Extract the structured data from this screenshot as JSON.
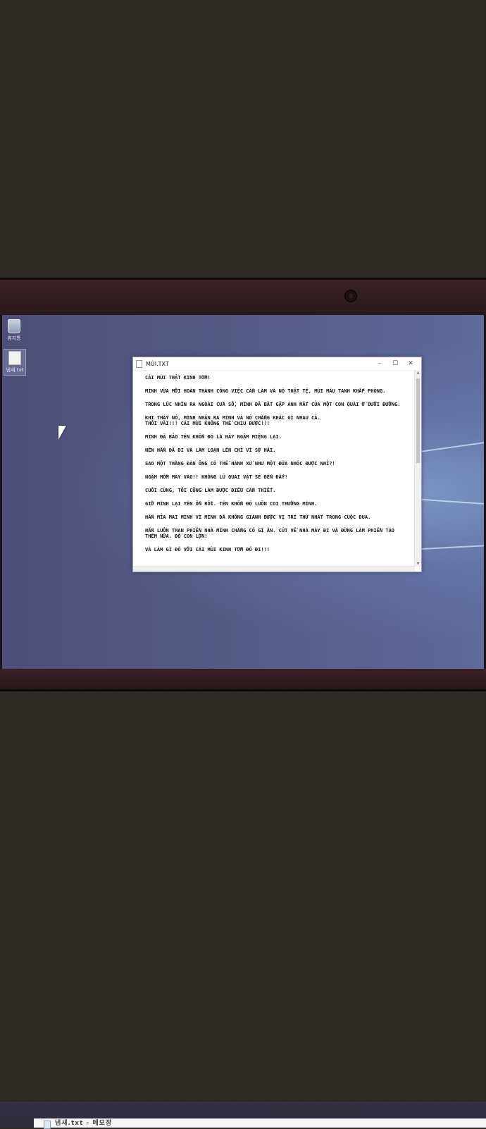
{
  "desktop": {
    "icons": [
      {
        "name": "recycle-bin",
        "label": "휴지통"
      },
      {
        "name": "text-file",
        "label": "냄새.txt"
      }
    ]
  },
  "notepad": {
    "title": "MÙI.TXT",
    "controls": {
      "minimize": "–",
      "maximize": "☐",
      "close": "✕"
    },
    "lines": [
      "CÁI MÙI THẬT KINH TỞM!",
      "MÌNH VỪA MỚI HOÀN THÀNH CÔNG VIỆC CẦN LÀM VÀ NÓ THẬT TỆ, MÙI MÁU TANH KHẮP PHÒNG.",
      "TRONG LÚC NHÌN RA NGOÀI CỬA SỔ, MÌNH ĐÃ BẮT GẶP ÁNH MẮT CỦA MỘT CON QUÁI Ở DƯỚI ĐƯỜNG.",
      "KHI THẤY NÓ, MÌNH NHẬN RA MÌNH VÀ NÓ CHẲNG KHÁC GÌ NHAU CẢ.\nTHỐI VÃI!!! CÁI MÙI KHÔNG THỂ CHỊU ĐƯỢC!!!",
      "MÌNH ĐÃ BẢO TÊN KHỐN ĐÓ LÀ HÃY NGẬM MIỆNG LẠI.",
      "NÊN HẮN ĐÃ ĐI VÀ LÀM LOẠN LÊN CHỈ VÌ SỢ HÃI.",
      "SAO MỘT THẰNG ĐÀN ÔNG CÓ THỂ HÀNH XỬ NHƯ MỘT ĐỨA NHÓC ĐƯỢC NHỈ?!",
      "NGẬM MỒM MÀY VÀO!! KHÔNG LŨ QUÁI VẬT SẼ ĐẾN ĐẤY!",
      "CUỐI CÙNG, TÔI CŨNG LÀM ĐƯỢC ĐIỀU CẦN THIẾT.",
      "GIỜ MÌNH LẠI YÊN ỔN RỒI. TÊN KHỐN ĐÓ LUÔN COI THƯỜNG MÌNH.",
      "HẮN MỈA MAI MÌNH VÌ MÌNH ĐÃ KHÔNG GIÀNH ĐƯỢC VỊ TRÍ THỨ NHẤT TRONG CUỘC ĐUA.",
      "HẮN LUÔN THAN PHIỀN NHÀ MÌNH CHẲNG CÓ GÌ ĂN. CÚT VỀ NHÀ MÀY ĐI VÀ ĐỪNG LÀM PHIỀN TAO THÊM NỮA. ĐỒ CON LỢN!",
      "VÀ LÀM GÌ ĐÓ VỚI CÁI MÙI KINH TỞM ĐÓ ĐI!!!"
    ]
  },
  "bottom_window": {
    "title": "냄새.txt - 메모장"
  }
}
